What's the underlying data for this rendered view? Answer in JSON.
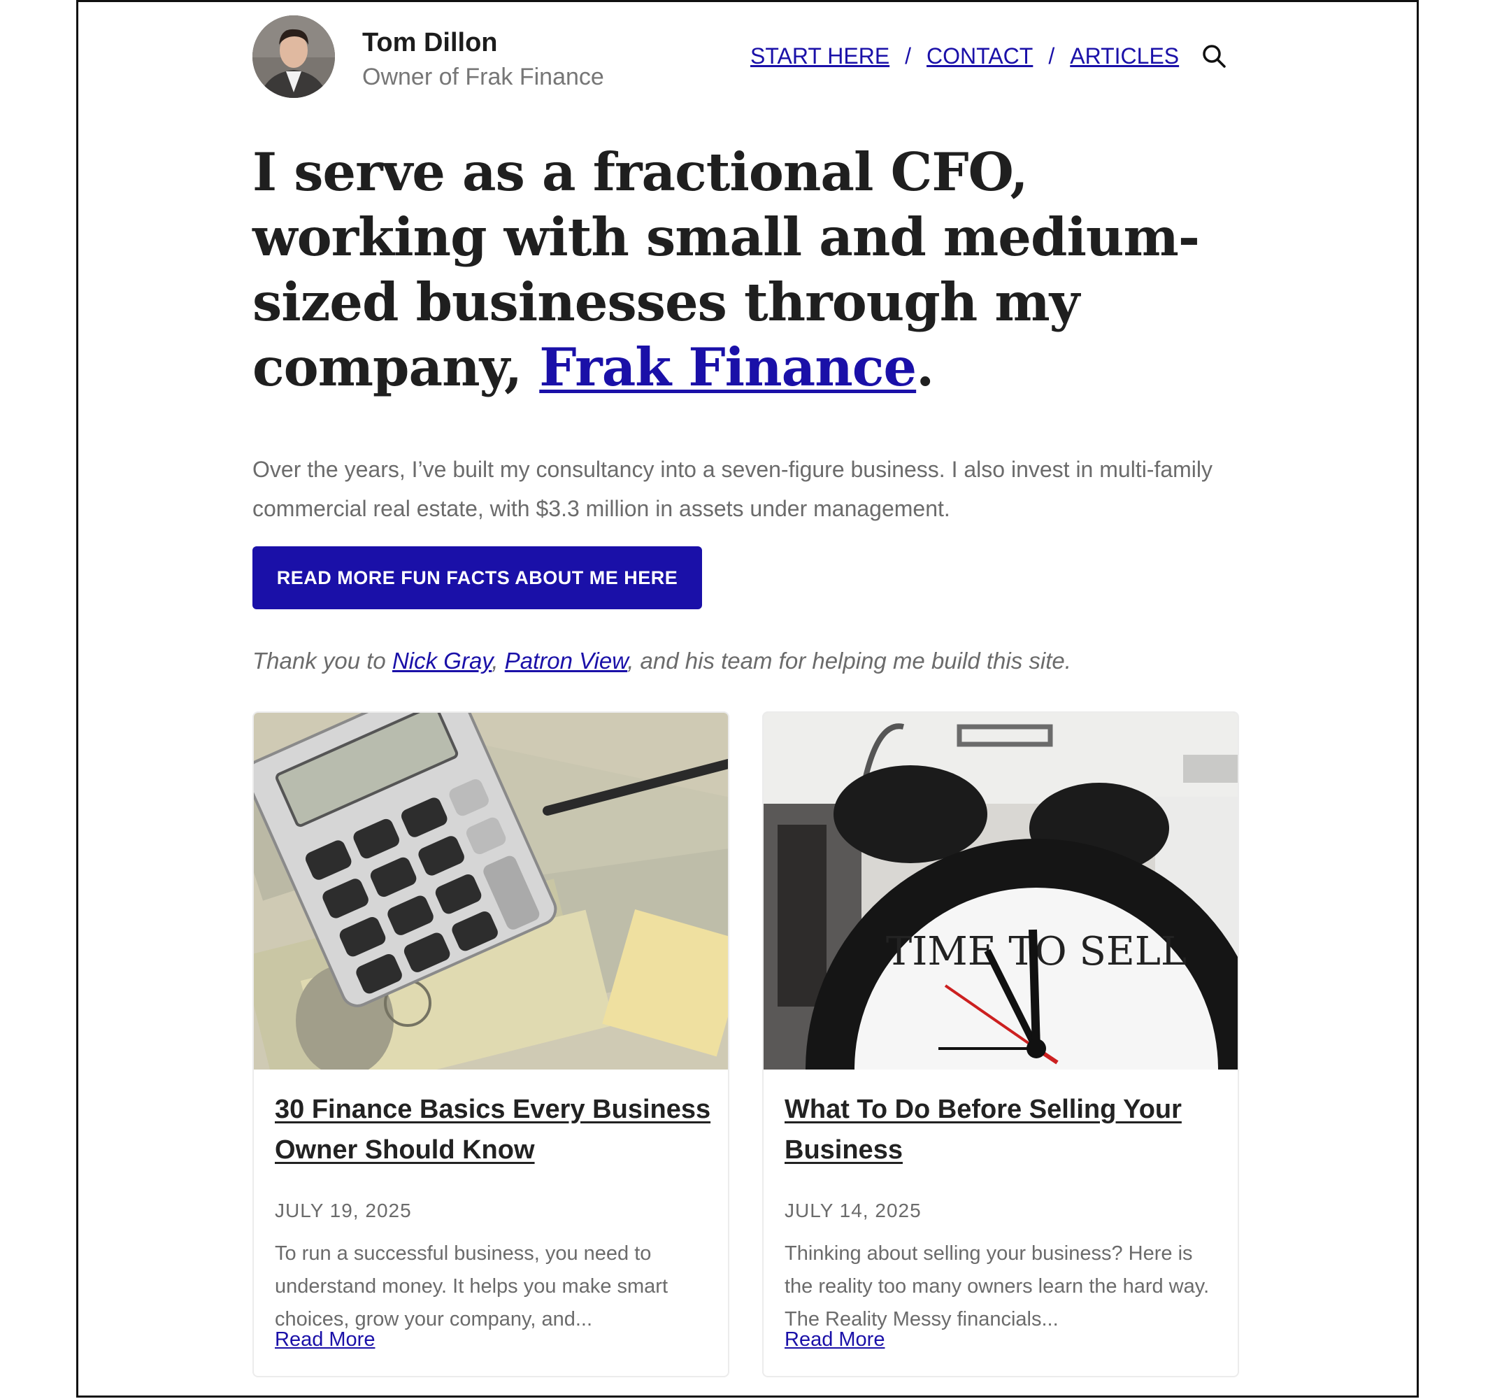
{
  "header": {
    "author_name": "Tom Dillon",
    "author_role": "Owner of Frak Finance",
    "nav": [
      {
        "label": "START HERE"
      },
      {
        "label": "CONTACT"
      },
      {
        "label": "ARTICLES"
      }
    ],
    "nav_separator": "/",
    "search_icon": "search-icon"
  },
  "hero": {
    "headline_before": "I serve as a fractional CFO, working with small and medium-sized businesses through my company, ",
    "headline_link": "Frak Finance",
    "headline_after": ".",
    "intro": "Over the years, I’ve built my consultancy into a seven-figure business. I also invest in multi-family commercial real estate, with $3.3 million in assets under management.",
    "cta_label": "READ MORE FUN FACTS ABOUT ME HERE"
  },
  "thanks": {
    "before": "Thank you to ",
    "link1": "Nick Gray",
    "sep": ", ",
    "link2": "Patron View",
    "after": ", and his team for helping me build this site."
  },
  "articles": [
    {
      "title": "30 Finance Basics Every Business Owner Should Know",
      "date": "JULY 19, 2025",
      "excerpt": "To run a successful business, you need to understand money. It helps you make smart choices, grow your company, and...",
      "read_more": "Read More"
    },
    {
      "title": "What To Do Before Selling Your Business",
      "date": "JULY 14, 2025",
      "excerpt": "Thinking about selling your business? Here is the reality too many owners learn the hard way. The Reality Messy financials...",
      "read_more": "Read More"
    }
  ],
  "images": {
    "card2_clock_text": "TIME TO SELL"
  },
  "colors": {
    "accent": "#1a10a8",
    "text": "#1f1f1f",
    "muted": "#6b6b6b"
  }
}
